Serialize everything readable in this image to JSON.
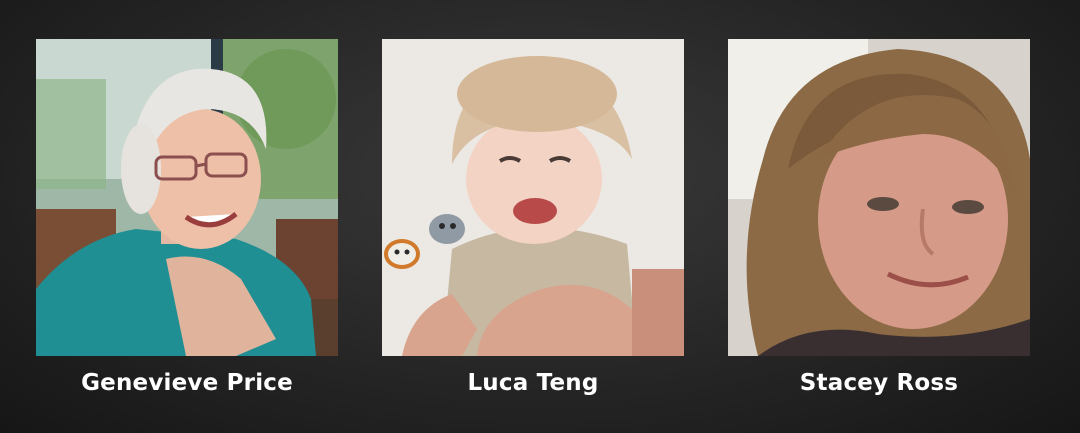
{
  "people": [
    {
      "name": "Genevieve Price",
      "photo_icon": "portrait-photo"
    },
    {
      "name": "Luca Teng",
      "photo_icon": "portrait-photo"
    },
    {
      "name": "Stacey Ross",
      "photo_icon": "portrait-photo"
    }
  ]
}
